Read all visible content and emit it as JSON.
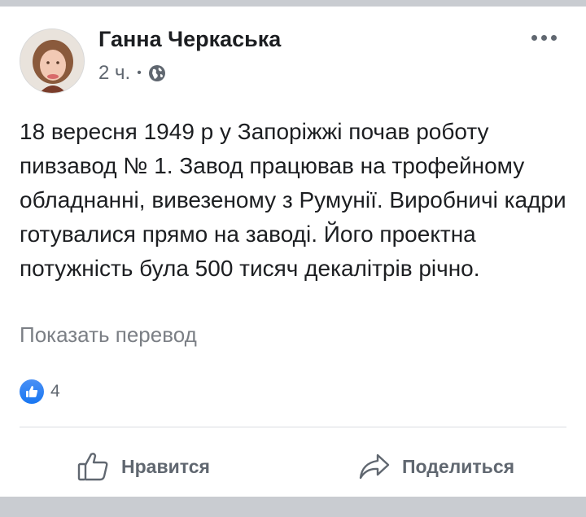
{
  "post": {
    "author_name": "Ганна Черкаська",
    "timestamp": "2 ч.",
    "separator": "•",
    "privacy_icon": "globe-icon",
    "text": "18 вересня 1949 р у Запоріжжі почав роботу пивзавод № 1. Завод працював на трофейному обладнанні, вивезеному з Румунії. Виробничі кадри готувалися прямо на заводі. Його проектна потужність була 500 тисяч декалітрів річно.",
    "translate_link": "Показать перевод"
  },
  "reactions": {
    "icon": "like-reaction-icon",
    "count": "4"
  },
  "actions": {
    "like_label": "Нравится",
    "share_label": "Поделиться"
  },
  "colors": {
    "accent": "#1877f2",
    "secondary_text": "#606770",
    "separator_band": "#c9ccd1"
  }
}
